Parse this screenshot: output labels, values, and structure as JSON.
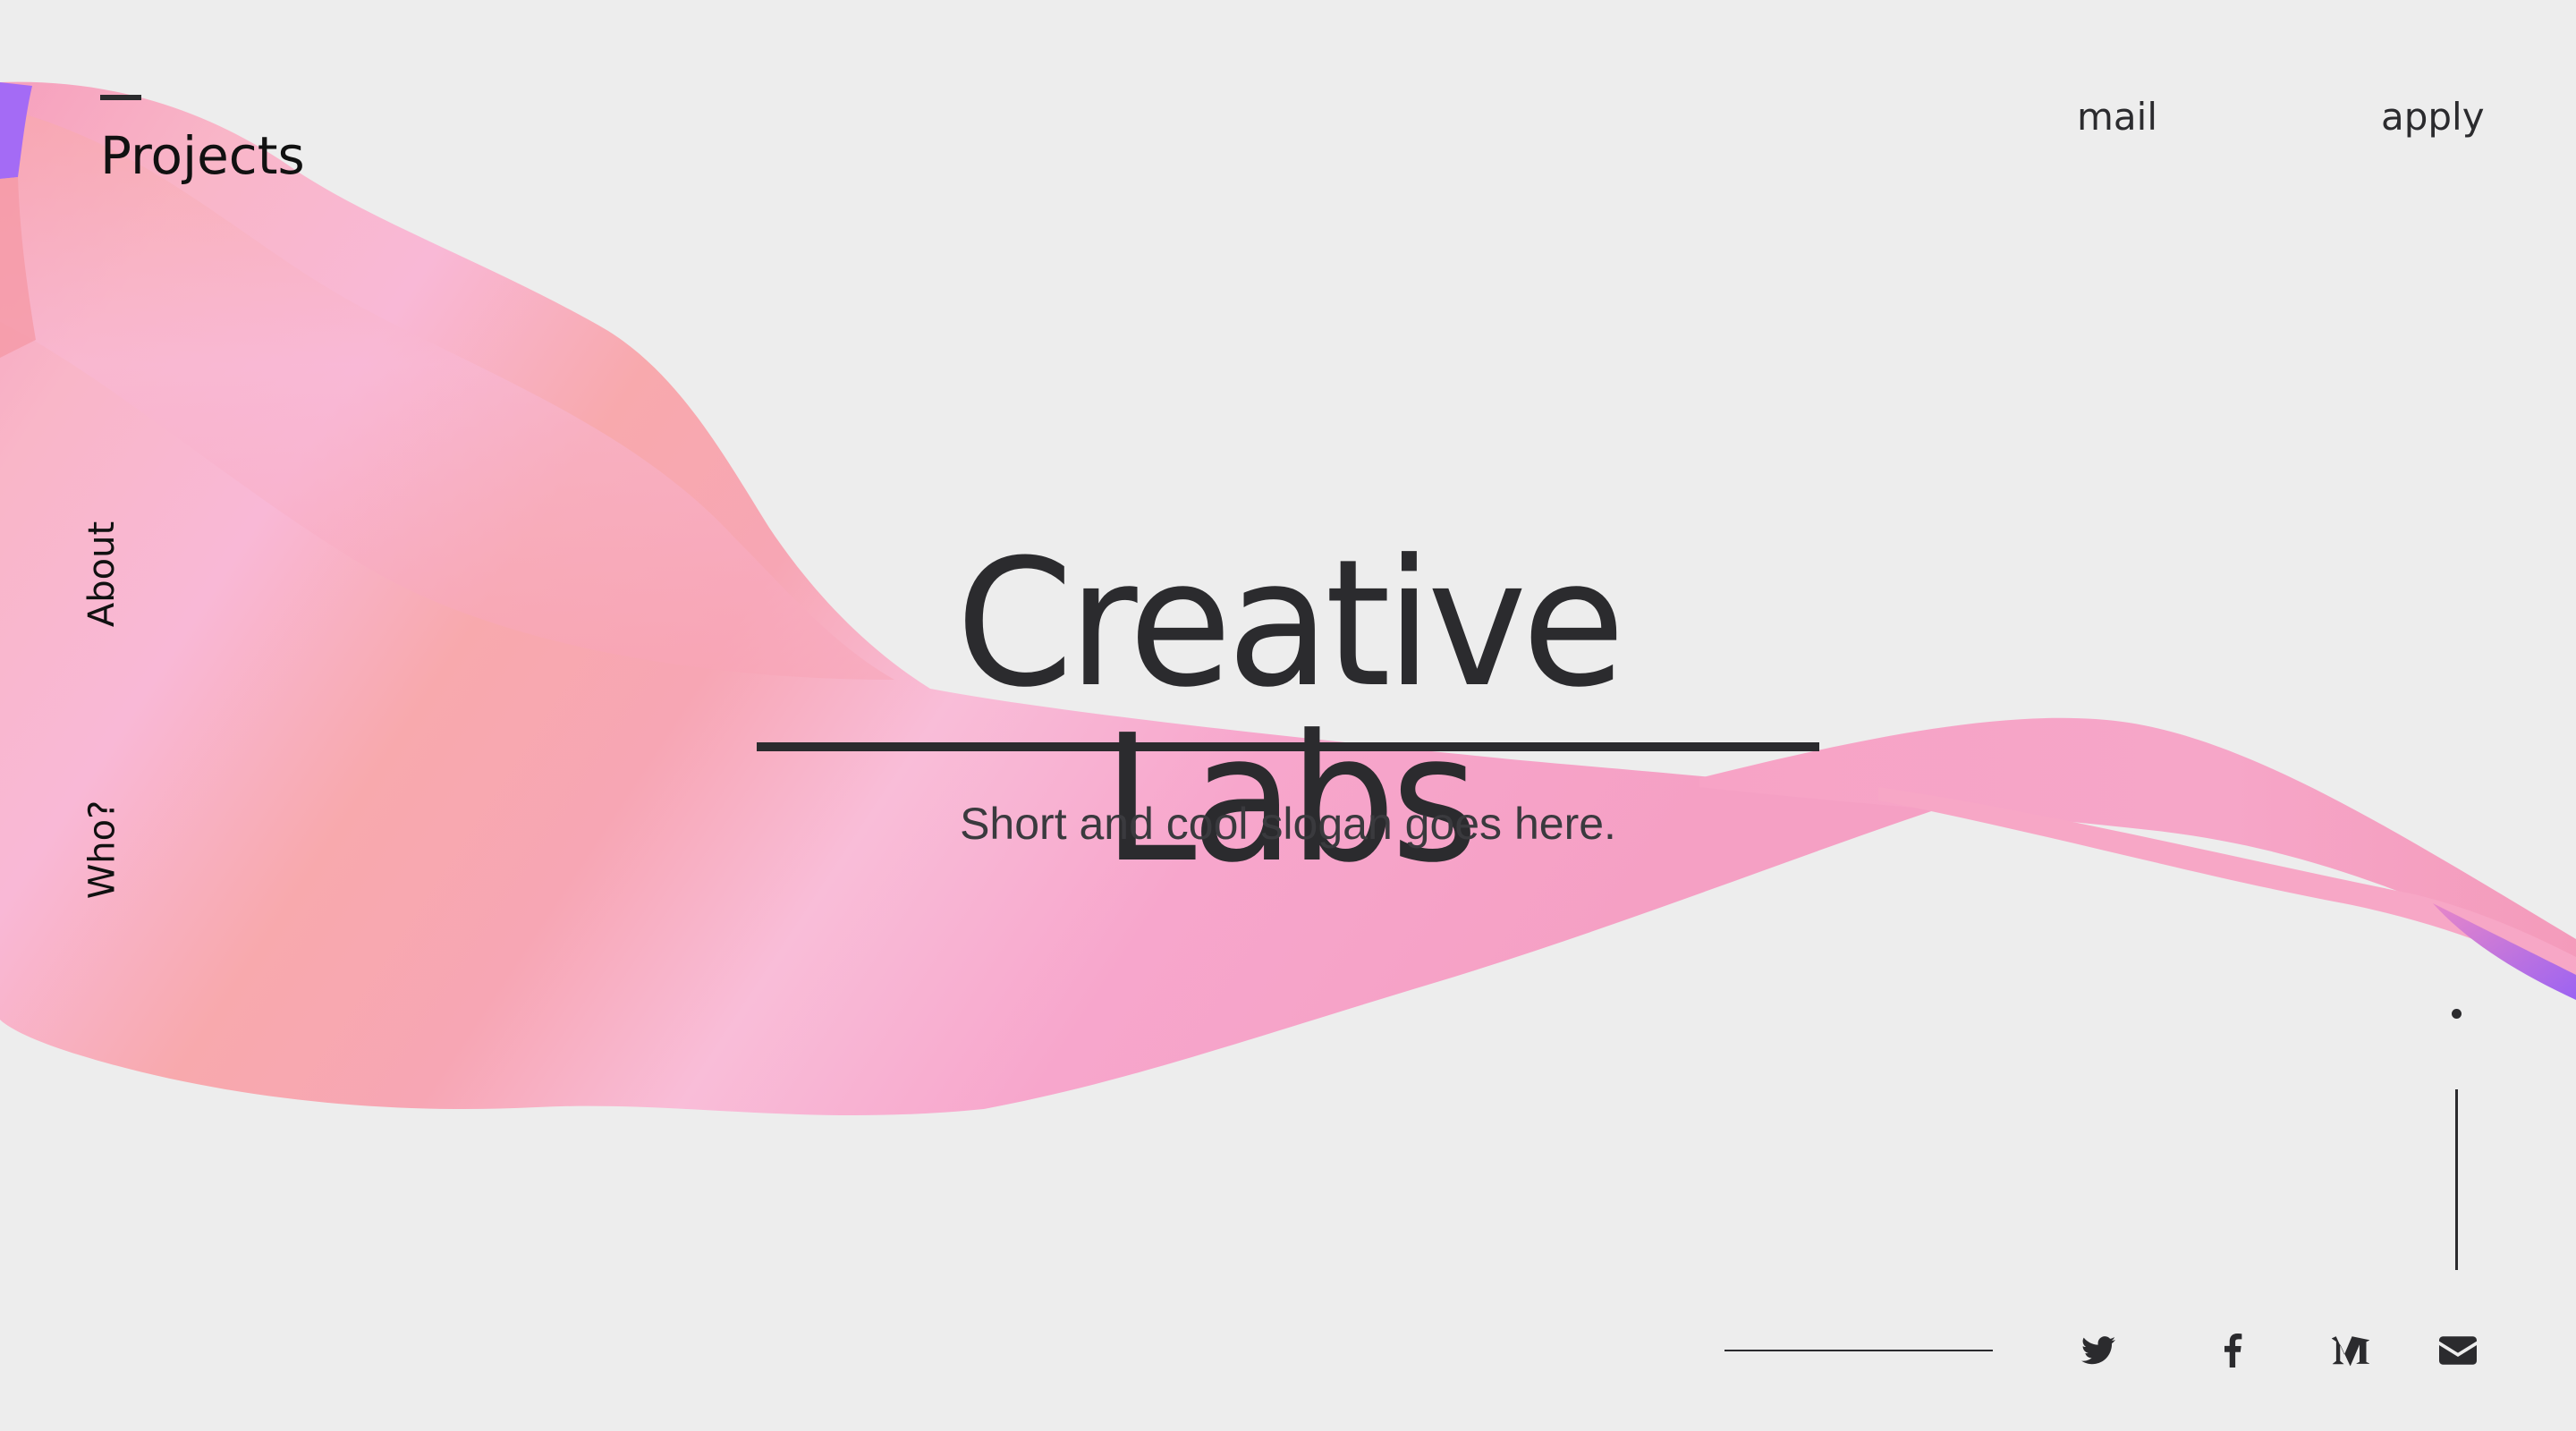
{
  "nav": {
    "projects": "Projects",
    "about": "About",
    "who": "Who?",
    "mail": "mail",
    "apply": "apply"
  },
  "hero": {
    "title": "Creative Labs",
    "slogan": "Short and cool slogan goes here."
  },
  "social": [
    {
      "name": "twitter",
      "icon": "twitter-icon"
    },
    {
      "name": "facebook",
      "icon": "facebook-icon"
    },
    {
      "name": "medium",
      "icon": "medium-icon"
    },
    {
      "name": "email",
      "icon": "envelope-icon"
    }
  ],
  "colors": {
    "background": "#ededed",
    "text": "#2b2b2e",
    "ribbon_pink": "#f9a8c0",
    "ribbon_salmon": "#f8a4a4",
    "ribbon_purple": "#a46bf5"
  }
}
